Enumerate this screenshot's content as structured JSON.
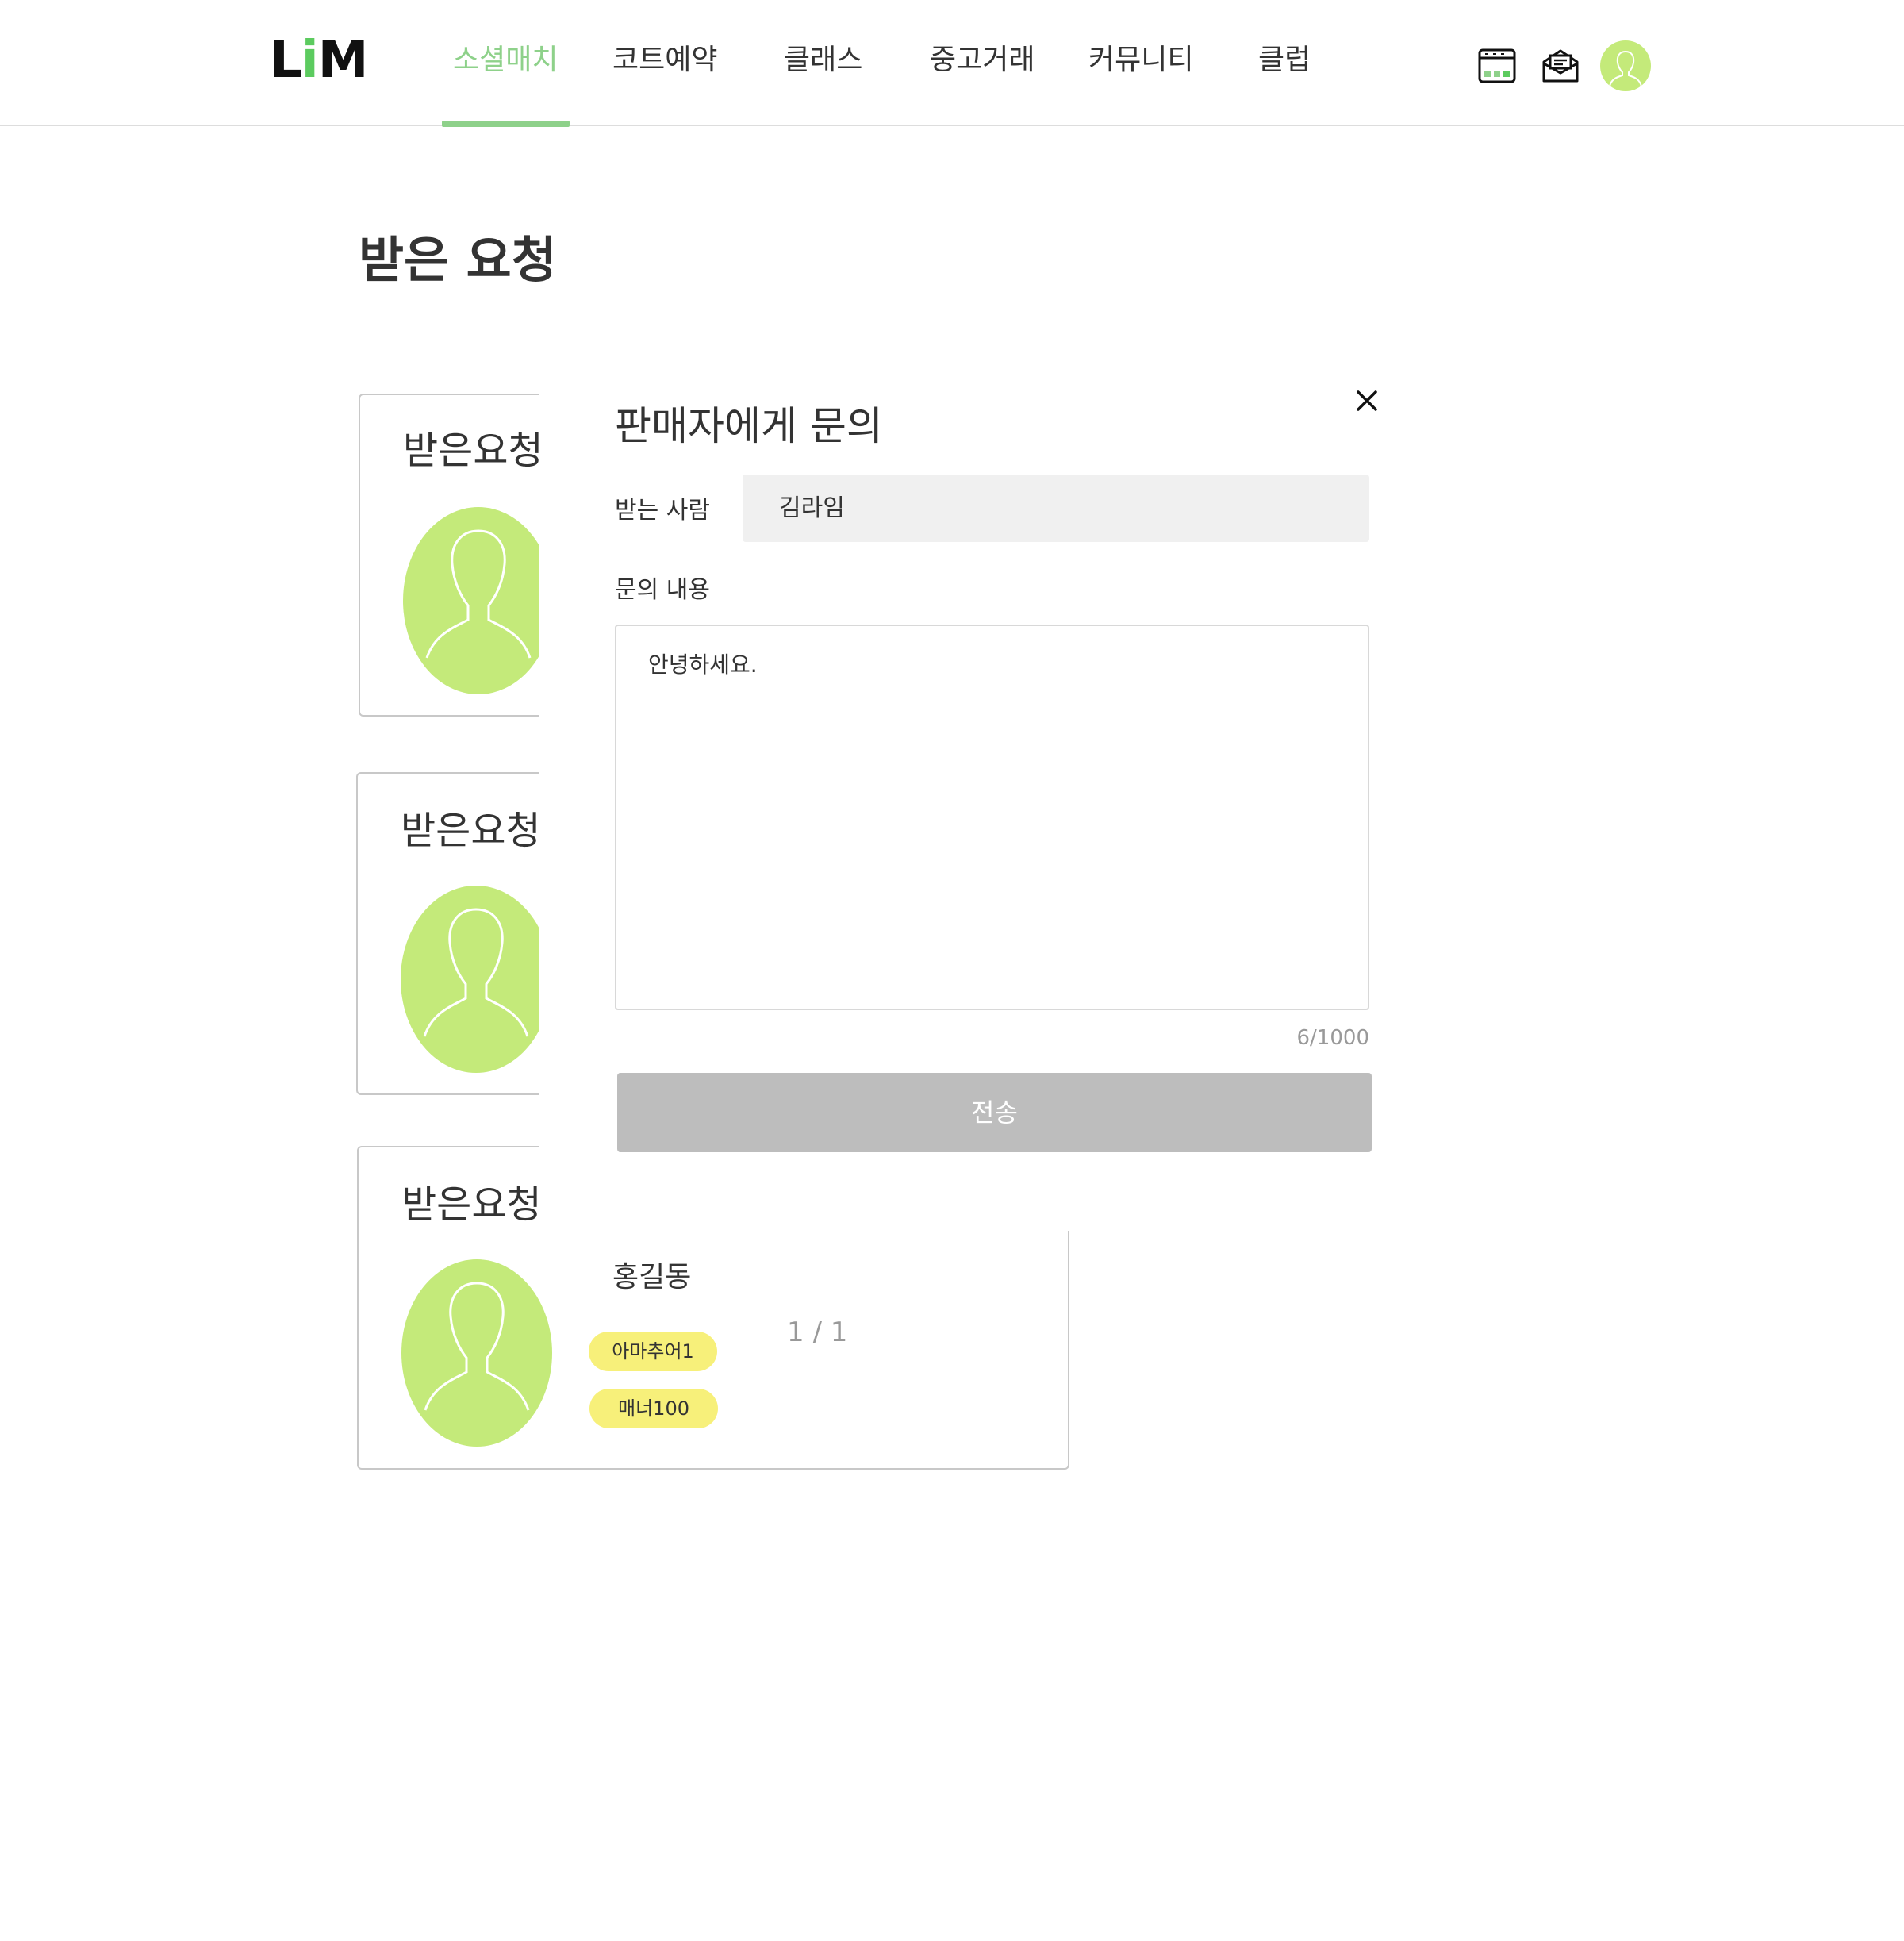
{
  "header": {
    "logo": {
      "part1": "L",
      "part2": "i",
      "part3": "M"
    },
    "nav": [
      {
        "label": "소셜매치",
        "active": true
      },
      {
        "label": "코트예약",
        "active": false
      },
      {
        "label": "클래스",
        "active": false
      },
      {
        "label": "중고거래",
        "active": false
      },
      {
        "label": "커뮤니티",
        "active": false
      },
      {
        "label": "클럽",
        "active": false
      }
    ],
    "icons": [
      "calendar-icon",
      "message-icon",
      "profile-avatar-icon"
    ]
  },
  "page": {
    "title": "받은 요청"
  },
  "cards": [
    {
      "title": "받은요청"
    },
    {
      "title": "받은요청"
    },
    {
      "title": "받은요청",
      "name": "홍길동",
      "badges": [
        "아마추어1",
        "매너100"
      ],
      "pager": "1 / 1"
    }
  ],
  "modal": {
    "title": "판매자에게 문의",
    "recipient_label": "받는 사람",
    "recipient_value": "김라임",
    "content_label": "문의 내용",
    "content_value": "안녕하세요.",
    "counter": "6/1000",
    "submit_label": "전송"
  },
  "colors": {
    "accent_green": "#8ed18a",
    "logo_green": "#5ccb5f",
    "avatar_green": "#c4ea7a",
    "badge_yellow": "#f7f07a",
    "button_disabled": "#bdbdbd"
  }
}
